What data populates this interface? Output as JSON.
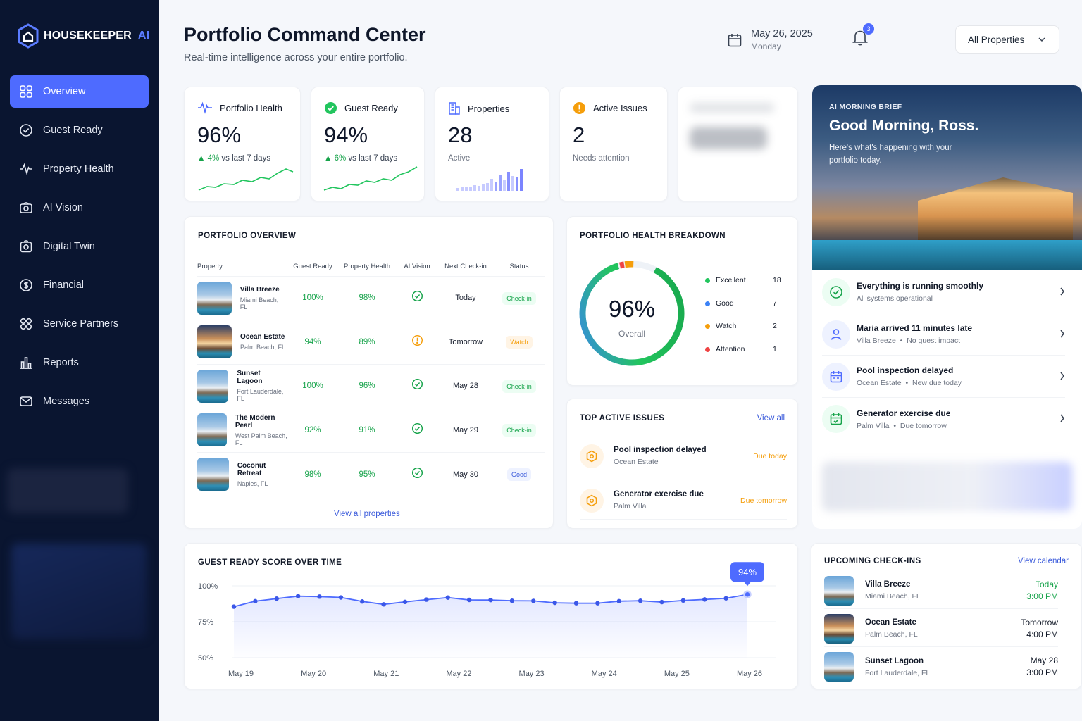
{
  "brand": {
    "name": "HOUSEKEEPER",
    "suffix": "AI"
  },
  "sidebar": {
    "items": [
      {
        "label": "Overview",
        "icon": "grid-icon",
        "active": true
      },
      {
        "label": "Guest Ready",
        "icon": "check-circle-icon"
      },
      {
        "label": "Property Health",
        "icon": "pulse-icon"
      },
      {
        "label": "AI Vision",
        "icon": "camera-icon"
      },
      {
        "label": "Digital Twin",
        "icon": "cube-camera-icon"
      },
      {
        "label": "Financial",
        "icon": "dollar-circle-icon"
      },
      {
        "label": "Service Partners",
        "icon": "partners-icon"
      },
      {
        "label": "Reports",
        "icon": "bar-chart-icon"
      },
      {
        "label": "Messages",
        "icon": "envelope-icon"
      }
    ]
  },
  "header": {
    "title": "Portfolio Command Center",
    "subtitle": "Real-time intelligence across your entire portfolio.",
    "date": "May 26, 2025",
    "weekday": "Monday",
    "notifications": "3",
    "filter": "All Properties"
  },
  "kpis": {
    "health": {
      "label": "Portfolio Health",
      "value": "96%",
      "delta": "4%",
      "delta_text": "vs last 7 days"
    },
    "ready": {
      "label": "Guest Ready",
      "value": "94%",
      "delta": "6%",
      "delta_text": "vs last 7 days"
    },
    "properties": {
      "label": "Properties",
      "value": "28",
      "sub": "Active"
    },
    "issues": {
      "label": "Active Issues",
      "value": "2",
      "sub": "Needs attention"
    }
  },
  "overview": {
    "title": "PORTFOLIO OVERVIEW",
    "columns": [
      "Property",
      "Guest Ready",
      "Property Health",
      "AI Vision",
      "Next Check-in",
      "Status"
    ],
    "rows": [
      {
        "name": "Villa Breeze",
        "loc": "Miami Beach, FL",
        "ready": "100%",
        "health": "98%",
        "vision": "ok",
        "next": "Today",
        "status": "Check-in"
      },
      {
        "name": "Ocean Estate",
        "loc": "Palm Beach, FL",
        "ready": "94%",
        "health": "89%",
        "vision": "warn",
        "next": "Tomorrow",
        "status": "Watch"
      },
      {
        "name": "Sunset Lagoon",
        "loc": "Fort Lauderdale, FL",
        "ready": "100%",
        "health": "96%",
        "vision": "ok",
        "next": "May 28",
        "status": "Check-in"
      },
      {
        "name": "The Modern Pearl",
        "loc": "West Palm Beach, FL",
        "ready": "92%",
        "health": "91%",
        "vision": "ok",
        "next": "May 29",
        "status": "Check-in"
      },
      {
        "name": "Coconut Retreat",
        "loc": "Naples, FL",
        "ready": "98%",
        "health": "95%",
        "vision": "ok",
        "next": "May 30",
        "status": "Good"
      }
    ],
    "view_all": "View all properties"
  },
  "breakdown": {
    "title": "PORTFOLIO HEALTH BREAKDOWN",
    "value": "96%",
    "caption": "Overall",
    "segments": [
      {
        "label": "Excellent",
        "count": "18",
        "color": "#22c55e"
      },
      {
        "label": "Good",
        "count": "7",
        "color": "#3b82f6"
      },
      {
        "label": "Watch",
        "count": "2",
        "color": "#f59e0b"
      },
      {
        "label": "Attention",
        "count": "1",
        "color": "#ef4444"
      }
    ]
  },
  "issues": {
    "title": "TOP ACTIVE ISSUES",
    "view_all": "View all",
    "items": [
      {
        "title": "Pool inspection delayed",
        "place": "Ocean Estate",
        "due": "Due today"
      },
      {
        "title": "Generator exercise due",
        "place": "Palm Villa",
        "due": "Due tomorrow"
      }
    ]
  },
  "brief": {
    "kicker": "AI MORNING BRIEF",
    "greeting": "Good Morning, Ross.",
    "intro": "Here's what's happening with your portfolio today.",
    "items": [
      {
        "title": "Everything is running smoothly",
        "sub": "All systems operational",
        "sub2": "",
        "icon": "check-circle-icon"
      },
      {
        "title": "Maria arrived 11 minutes late",
        "sub": "Villa Breeze",
        "sub2": "No guest impact",
        "icon": "user-icon"
      },
      {
        "title": "Pool inspection delayed",
        "sub": "Ocean Estate",
        "sub2": "New due today",
        "icon": "calendar-icon"
      },
      {
        "title": "Generator exercise due",
        "sub": "Palm Villa",
        "sub2": "Due tomorrow",
        "icon": "calendar-check-icon"
      }
    ]
  },
  "chart_data": {
    "type": "line",
    "title": "GUEST READY SCORE OVER TIME",
    "x_ticks": [
      "May 19",
      "May 20",
      "May 21",
      "May 22",
      "May 23",
      "May 24",
      "May 25",
      "May 26"
    ],
    "y_ticks": [
      "100%",
      "75%",
      "50%"
    ],
    "ylim": [
      50,
      100
    ],
    "series": [
      {
        "values": [
          85.5,
          89.3,
          91.1,
          92.8,
          92.5,
          91.9,
          89.1,
          87.1,
          88.8,
          90.4,
          91.8,
          90.2,
          90.1,
          89.6,
          89.5,
          88.2,
          87.9,
          87.9,
          89.3,
          89.6,
          88.7,
          89.8,
          90.5,
          91.3,
          94.0
        ]
      }
    ],
    "callout": "94%",
    "grid": true
  },
  "checkins": {
    "title": "UPCOMING CHECK-INS",
    "view_all": "View calendar",
    "items": [
      {
        "name": "Villa Breeze",
        "loc": "Miami Beach, FL",
        "day": "Today",
        "time": "3:00 PM"
      },
      {
        "name": "Ocean Estate",
        "loc": "Palm Beach, FL",
        "day": "Tomorrow",
        "time": "4:00 PM"
      },
      {
        "name": "Sunset Lagoon",
        "loc": "Fort Lauderdale, FL",
        "day": "May 28",
        "time": "3:00 PM"
      }
    ]
  }
}
